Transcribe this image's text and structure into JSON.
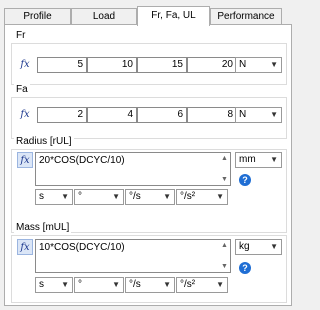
{
  "tabs": [
    "Profile",
    "Load",
    "Fr, Fa, UL",
    "Performance"
  ],
  "fr": {
    "label": "Fr",
    "values": [
      "5",
      "10",
      "15",
      "20"
    ],
    "unit": "N"
  },
  "fa": {
    "label": "Fa",
    "values": [
      "2",
      "4",
      "6",
      "8"
    ],
    "unit": "N"
  },
  "radius": {
    "label": "Radius [rUL]",
    "expression": "20*COS(DCYC/10)",
    "unit": "mm",
    "units_row": [
      "s",
      "°",
      "°/s",
      "°/s²"
    ]
  },
  "mass": {
    "label": "Mass [mUL]",
    "expression": "10*COS(DCYC/10)",
    "unit": "kg",
    "units_row": [
      "s",
      "°",
      "°/s",
      "°/s²"
    ]
  },
  "fx_symbol": "fx",
  "help_symbol": "?",
  "dropdown_arrow": "▼"
}
